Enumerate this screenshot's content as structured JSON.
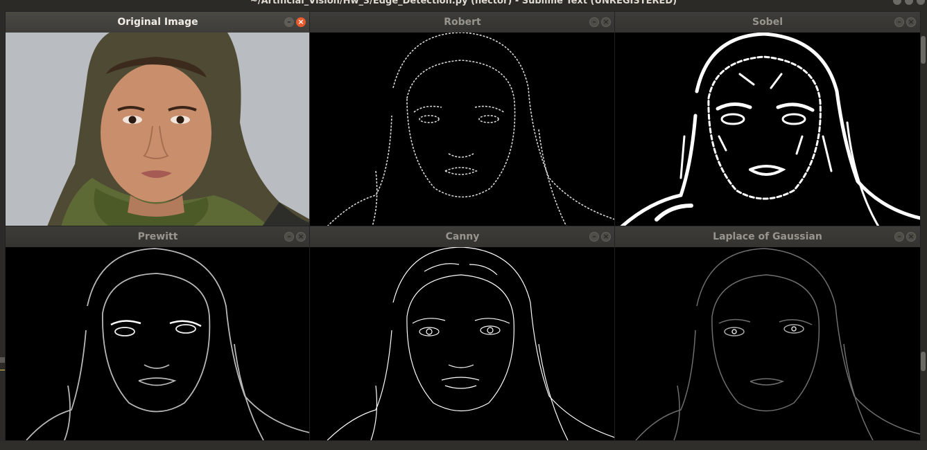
{
  "background_window": {
    "title": "~/Artificial_Vision/Hw_3/Edge_Detection.py (hector) - Sublime Text (UNREGISTERED)"
  },
  "windows": [
    {
      "title": "Original Image",
      "active": true,
      "image": "original-photo"
    },
    {
      "title": "Robert",
      "active": false,
      "image": "robert-edges"
    },
    {
      "title": "Sobel",
      "active": false,
      "image": "sobel-edges"
    },
    {
      "title": "Prewitt",
      "active": false,
      "image": "prewitt-edges"
    },
    {
      "title": "Canny",
      "active": false,
      "image": "canny-edges"
    },
    {
      "title": "Laplace of Gaussian",
      "active": false,
      "image": "log-edges"
    }
  ],
  "controls": {
    "minimize_glyph": "–",
    "close_glyph": "×"
  },
  "colors": {
    "close_active": "#e85a2b",
    "titlebar": "#3e3d39",
    "edge_background": "#000000"
  }
}
